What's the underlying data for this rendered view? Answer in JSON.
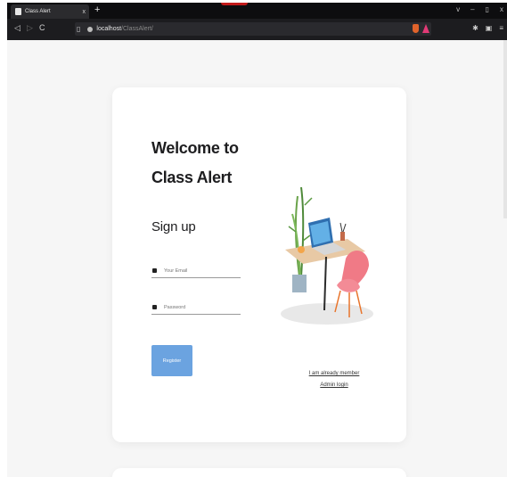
{
  "browser": {
    "tab_title": "Class Alert",
    "tab_close": "x",
    "new_tab": "+",
    "url_host": "localhost",
    "url_path": "/ClassAlert/",
    "window_controls": [
      "v",
      "–",
      "▯",
      "x"
    ],
    "nav": [
      "◁",
      "▷",
      "C"
    ]
  },
  "page": {
    "heading_line1": "Welcome to",
    "heading_line2": "Class Alert",
    "subheading": "Sign up",
    "email_placeholder": "Your Email",
    "password_placeholder": "Password",
    "register_label": "Register",
    "member_link": "I am already member",
    "admin_link": "Admin login"
  },
  "colors": {
    "accent": "#6ba3e0",
    "chair": "#f07a86"
  }
}
